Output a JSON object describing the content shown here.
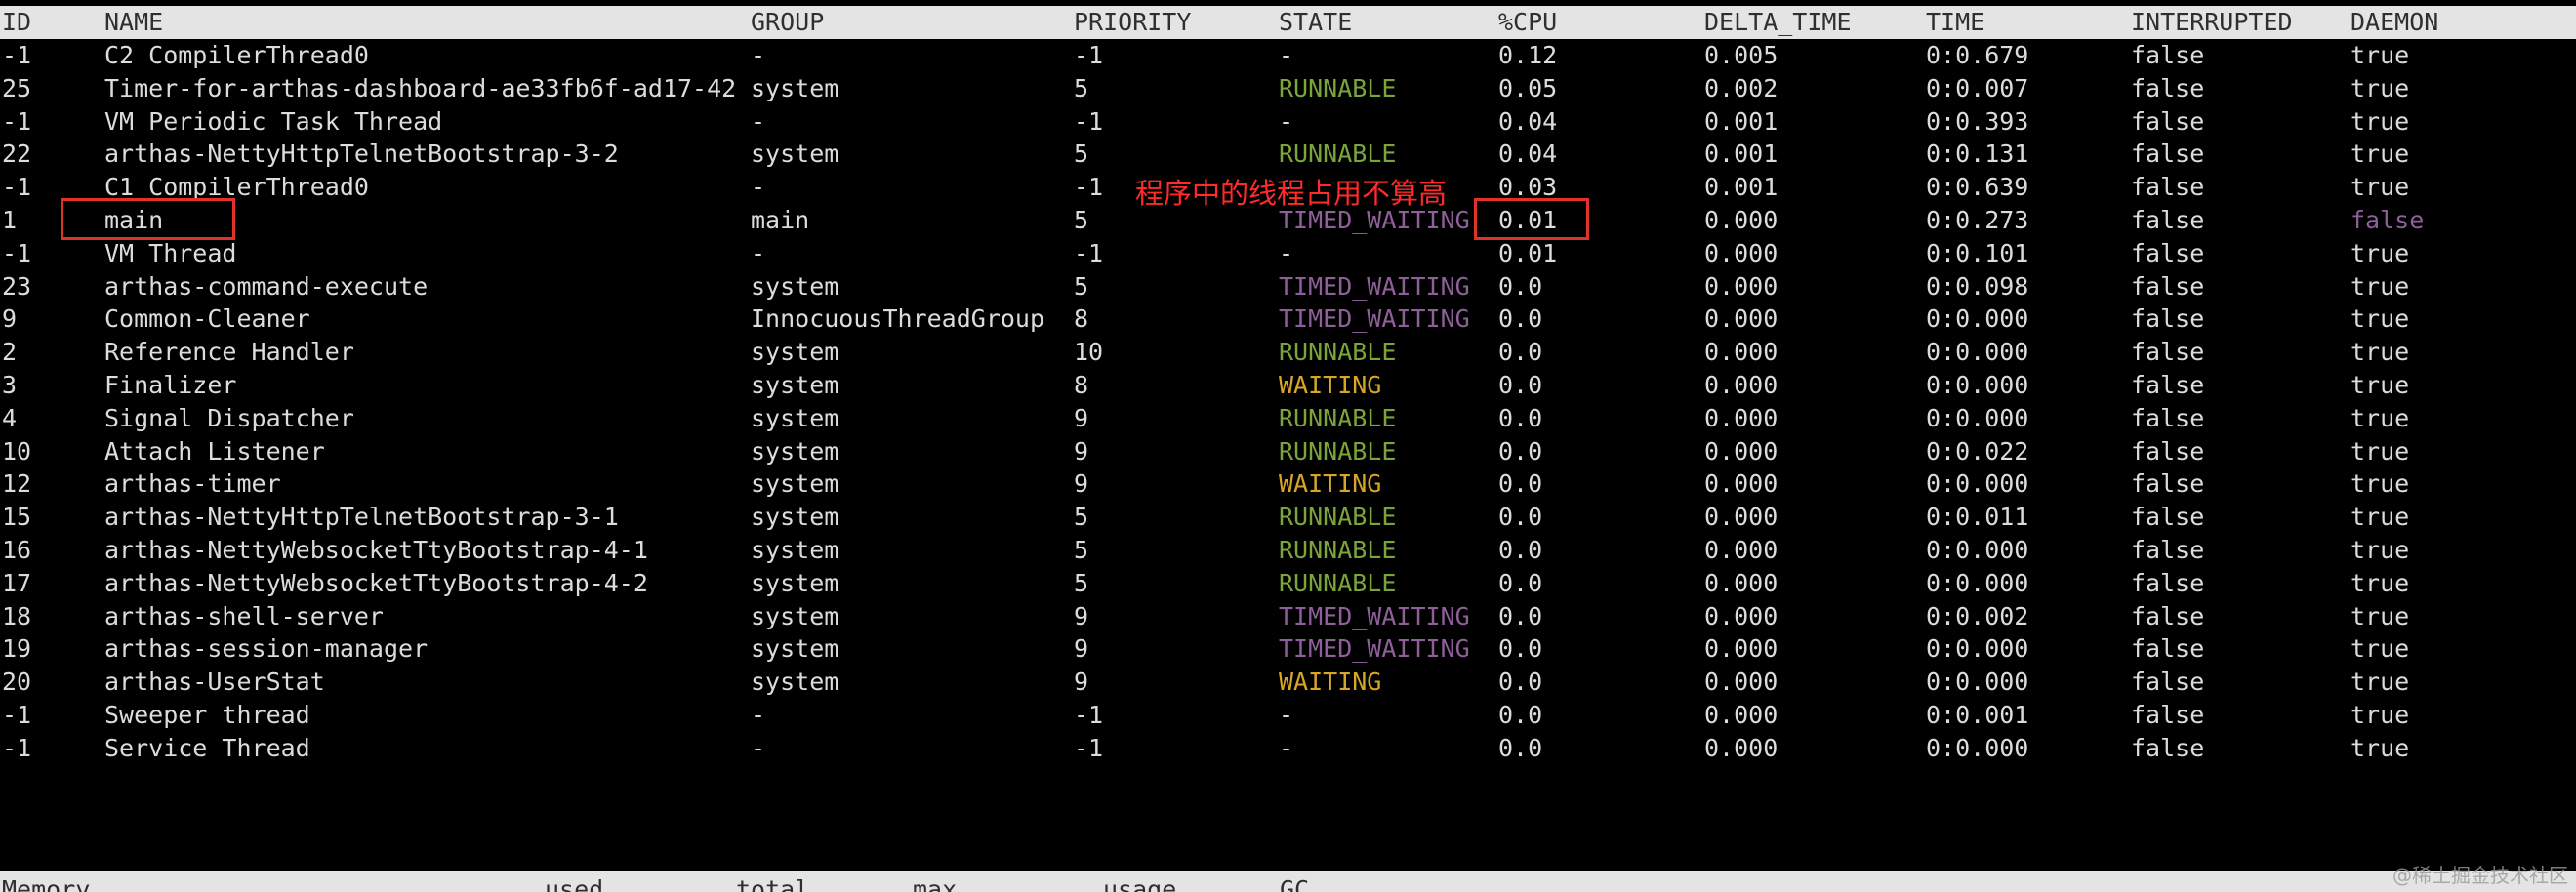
{
  "columns": {
    "id": "ID",
    "name": "NAME",
    "group": "GROUP",
    "priority": "PRIORITY",
    "state": "STATE",
    "cpu": "%CPU",
    "delta_time": "DELTA_TIME",
    "time": "TIME",
    "interrupted": "INTERRUPTED",
    "daemon": "DAEMON"
  },
  "threads": [
    {
      "id": "-1",
      "name": "C2 CompilerThread0",
      "group": "-",
      "priority": "-1",
      "state": "-",
      "cpu": "0.12",
      "delta_time": "0.005",
      "time": "0:0.679",
      "interrupted": "false",
      "daemon": "true"
    },
    {
      "id": "25",
      "name": "Timer-for-arthas-dashboard-ae33fb6f-ad17-42",
      "group": "system",
      "priority": "5",
      "state": "RUNNABLE",
      "cpu": "0.05",
      "delta_time": "0.002",
      "time": "0:0.007",
      "interrupted": "false",
      "daemon": "true"
    },
    {
      "id": "-1",
      "name": "VM Periodic Task Thread",
      "group": "-",
      "priority": "-1",
      "state": "-",
      "cpu": "0.04",
      "delta_time": "0.001",
      "time": "0:0.393",
      "interrupted": "false",
      "daemon": "true"
    },
    {
      "id": "22",
      "name": "arthas-NettyHttpTelnetBootstrap-3-2",
      "group": "system",
      "priority": "5",
      "state": "RUNNABLE",
      "cpu": "0.04",
      "delta_time": "0.001",
      "time": "0:0.131",
      "interrupted": "false",
      "daemon": "true"
    },
    {
      "id": "-1",
      "name": "C1 CompilerThread0",
      "group": "-",
      "priority": "-1",
      "state": "-",
      "cpu": "0.03",
      "delta_time": "0.001",
      "time": "0:0.639",
      "interrupted": "false",
      "daemon": "true"
    },
    {
      "id": "1",
      "name": "main",
      "group": "main",
      "priority": "5",
      "state": "TIMED_WAITING",
      "cpu": "0.01",
      "delta_time": "0.000",
      "time": "0:0.273",
      "interrupted": "false",
      "daemon": "false"
    },
    {
      "id": "-1",
      "name": "VM Thread",
      "group": "-",
      "priority": "-1",
      "state": "-",
      "cpu": "0.01",
      "delta_time": "0.000",
      "time": "0:0.101",
      "interrupted": "false",
      "daemon": "true"
    },
    {
      "id": "23",
      "name": "arthas-command-execute",
      "group": "system",
      "priority": "5",
      "state": "TIMED_WAITING",
      "cpu": "0.0",
      "delta_time": "0.000",
      "time": "0:0.098",
      "interrupted": "false",
      "daemon": "true"
    },
    {
      "id": "9",
      "name": "Common-Cleaner",
      "group": "InnocuousThreadGroup",
      "priority": "8",
      "state": "TIMED_WAITING",
      "cpu": "0.0",
      "delta_time": "0.000",
      "time": "0:0.000",
      "interrupted": "false",
      "daemon": "true"
    },
    {
      "id": "2",
      "name": "Reference Handler",
      "group": "system",
      "priority": "10",
      "state": "RUNNABLE",
      "cpu": "0.0",
      "delta_time": "0.000",
      "time": "0:0.000",
      "interrupted": "false",
      "daemon": "true"
    },
    {
      "id": "3",
      "name": "Finalizer",
      "group": "system",
      "priority": "8",
      "state": "WAITING",
      "cpu": "0.0",
      "delta_time": "0.000",
      "time": "0:0.000",
      "interrupted": "false",
      "daemon": "true"
    },
    {
      "id": "4",
      "name": "Signal Dispatcher",
      "group": "system",
      "priority": "9",
      "state": "RUNNABLE",
      "cpu": "0.0",
      "delta_time": "0.000",
      "time": "0:0.000",
      "interrupted": "false",
      "daemon": "true"
    },
    {
      "id": "10",
      "name": "Attach Listener",
      "group": "system",
      "priority": "9",
      "state": "RUNNABLE",
      "cpu": "0.0",
      "delta_time": "0.000",
      "time": "0:0.022",
      "interrupted": "false",
      "daemon": "true"
    },
    {
      "id": "12",
      "name": "arthas-timer",
      "group": "system",
      "priority": "9",
      "state": "WAITING",
      "cpu": "0.0",
      "delta_time": "0.000",
      "time": "0:0.000",
      "interrupted": "false",
      "daemon": "true"
    },
    {
      "id": "15",
      "name": "arthas-NettyHttpTelnetBootstrap-3-1",
      "group": "system",
      "priority": "5",
      "state": "RUNNABLE",
      "cpu": "0.0",
      "delta_time": "0.000",
      "time": "0:0.011",
      "interrupted": "false",
      "daemon": "true"
    },
    {
      "id": "16",
      "name": "arthas-NettyWebsocketTtyBootstrap-4-1",
      "group": "system",
      "priority": "5",
      "state": "RUNNABLE",
      "cpu": "0.0",
      "delta_time": "0.000",
      "time": "0:0.000",
      "interrupted": "false",
      "daemon": "true"
    },
    {
      "id": "17",
      "name": "arthas-NettyWebsocketTtyBootstrap-4-2",
      "group": "system",
      "priority": "5",
      "state": "RUNNABLE",
      "cpu": "0.0",
      "delta_time": "0.000",
      "time": "0:0.000",
      "interrupted": "false",
      "daemon": "true"
    },
    {
      "id": "18",
      "name": "arthas-shell-server",
      "group": "system",
      "priority": "9",
      "state": "TIMED_WAITING",
      "cpu": "0.0",
      "delta_time": "0.000",
      "time": "0:0.002",
      "interrupted": "false",
      "daemon": "true"
    },
    {
      "id": "19",
      "name": "arthas-session-manager",
      "group": "system",
      "priority": "9",
      "state": "TIMED_WAITING",
      "cpu": "0.0",
      "delta_time": "0.000",
      "time": "0:0.000",
      "interrupted": "false",
      "daemon": "true"
    },
    {
      "id": "20",
      "name": "arthas-UserStat",
      "group": "system",
      "priority": "9",
      "state": "WAITING",
      "cpu": "0.0",
      "delta_time": "0.000",
      "time": "0:0.000",
      "interrupted": "false",
      "daemon": "true"
    },
    {
      "id": "-1",
      "name": "Sweeper thread",
      "group": "-",
      "priority": "-1",
      "state": "-",
      "cpu": "0.0",
      "delta_time": "0.000",
      "time": "0:0.001",
      "interrupted": "false",
      "daemon": "true"
    },
    {
      "id": "-1",
      "name": "Service Thread",
      "group": "-",
      "priority": "-1",
      "state": "-",
      "cpu": "0.0",
      "delta_time": "0.000",
      "time": "0:0.000",
      "interrupted": "false",
      "daemon": "true"
    }
  ],
  "annotation": {
    "text": "程序中的线程占用不算高",
    "color": "#ff2a2a"
  },
  "memory_header": {
    "memory": "Memory",
    "used": "used",
    "total": "total",
    "max": "max",
    "usage": "usage",
    "gc": "GC"
  },
  "state_colors": {
    "RUNNABLE": "#7aa53b",
    "TIMED_WAITING": "#8e5f99",
    "WAITING": "#d8a626"
  },
  "watermark": "@稀土掘金技术社区"
}
